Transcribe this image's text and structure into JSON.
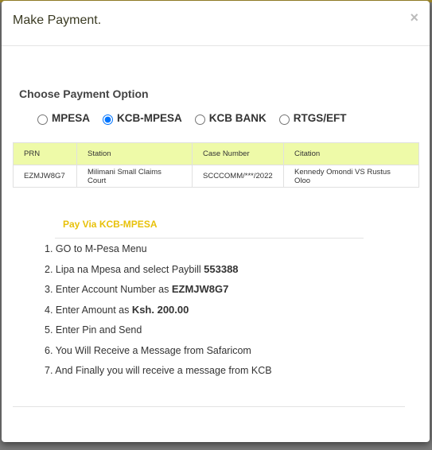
{
  "modal": {
    "title": "Make Payment.",
    "close": "×"
  },
  "choose_label": "Choose Payment Option",
  "options": [
    {
      "label": "MPESA",
      "checked": false
    },
    {
      "label": "KCB-MPESA",
      "checked": true
    },
    {
      "label": "KCB BANK",
      "checked": false
    },
    {
      "label": "RTGS/EFT",
      "checked": false
    }
  ],
  "table": {
    "headers": [
      "PRN",
      "Station",
      "Case Number",
      "Citation"
    ],
    "row": [
      "EZMJW8G7",
      "Milimani Small Claims Court",
      "SCCCOMM/***/2022",
      "Kennedy Omondi VS Rustus Oloo"
    ]
  },
  "pay_heading": "Pay Via KCB-MPESA",
  "steps": [
    {
      "n": "1.",
      "text": "GO to M-Pesa Menu",
      "bold": ""
    },
    {
      "n": "2.",
      "text": "Lipa na Mpesa and select Paybill ",
      "bold": "553388"
    },
    {
      "n": "3.",
      "text": "Enter Account Number as ",
      "bold": "EZMJW8G7"
    },
    {
      "n": "4.",
      "text": "Enter Amount as ",
      "bold": "Ksh. 200.00"
    },
    {
      "n": "5.",
      "text": "Enter Pin and Send",
      "bold": ""
    },
    {
      "n": "6.",
      "text": "You Will Receive a Message from Safaricom",
      "bold": ""
    },
    {
      "n": "7.",
      "text": "And Finally you will receive a message from KCB",
      "bold": ""
    }
  ],
  "colors": {
    "header_bg": "#eefaa8",
    "accent": "#e8c10a"
  }
}
